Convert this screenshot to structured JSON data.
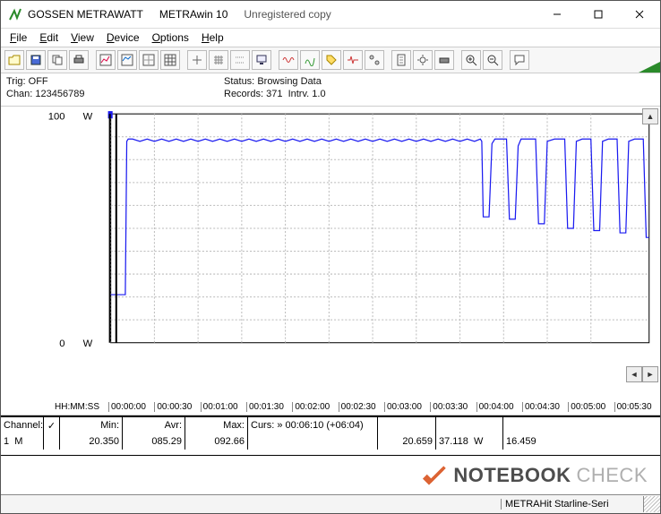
{
  "title": {
    "vendor": "GOSSEN METRAWATT",
    "app": "METRAwin 10",
    "status": "Unregistered copy"
  },
  "menu": {
    "file": "File",
    "edit": "Edit",
    "view": "View",
    "device": "Device",
    "options": "Options",
    "help": "Help"
  },
  "status": {
    "trig_label": "Trig:",
    "trig": "OFF",
    "chan_label": "Chan:",
    "chan": "123456789",
    "status_label": "Status:",
    "status": "Browsing Data",
    "records_label": "Records:",
    "records": "371",
    "intrv_label": "Intrv.",
    "intrv": "1.0"
  },
  "chart_data": {
    "type": "line",
    "title": "",
    "xlabel": "HH:MM:SS",
    "ylabel": "W",
    "ylim": [
      0,
      100
    ],
    "y_ticks": [
      0,
      100
    ],
    "y_unit": "W",
    "x_ticks": [
      "00:00:00",
      "00:00:30",
      "00:01:00",
      "00:01:30",
      "00:02:00",
      "00:02:30",
      "00:03:00",
      "00:03:30",
      "00:04:00",
      "00:04:30",
      "00:05:00",
      "00:05:30"
    ],
    "x_range_seconds": [
      0,
      370
    ],
    "series": [
      {
        "name": "Channel 1",
        "color": "#1a1af0",
        "points": [
          [
            0,
            21
          ],
          [
            3,
            21
          ],
          [
            4,
            21
          ],
          [
            5,
            21
          ],
          [
            6,
            21
          ],
          [
            7,
            21
          ],
          [
            8,
            21
          ],
          [
            9,
            21
          ],
          [
            10,
            21
          ],
          [
            11,
            88
          ],
          [
            12,
            89
          ],
          [
            15,
            89
          ],
          [
            20,
            88
          ],
          [
            25,
            89
          ],
          [
            30,
            88
          ],
          [
            35,
            89
          ],
          [
            40,
            88
          ],
          [
            45,
            89
          ],
          [
            50,
            88
          ],
          [
            55,
            89
          ],
          [
            60,
            88
          ],
          [
            65,
            89
          ],
          [
            70,
            88
          ],
          [
            75,
            89
          ],
          [
            80,
            88
          ],
          [
            85,
            89
          ],
          [
            90,
            88
          ],
          [
            95,
            89
          ],
          [
            100,
            88
          ],
          [
            105,
            89
          ],
          [
            110,
            88
          ],
          [
            115,
            89
          ],
          [
            120,
            88
          ],
          [
            125,
            89
          ],
          [
            130,
            88
          ],
          [
            135,
            89
          ],
          [
            140,
            88
          ],
          [
            145,
            89
          ],
          [
            150,
            88
          ],
          [
            155,
            89
          ],
          [
            160,
            88
          ],
          [
            165,
            89
          ],
          [
            170,
            88
          ],
          [
            175,
            89
          ],
          [
            180,
            88
          ],
          [
            185,
            89
          ],
          [
            190,
            88
          ],
          [
            195,
            89
          ],
          [
            200,
            88
          ],
          [
            205,
            89
          ],
          [
            210,
            88
          ],
          [
            215,
            89
          ],
          [
            220,
            88
          ],
          [
            225,
            89
          ],
          [
            230,
            88
          ],
          [
            235,
            89
          ],
          [
            240,
            88
          ],
          [
            245,
            89
          ],
          [
            250,
            88
          ],
          [
            254,
            89
          ],
          [
            255,
            88
          ],
          [
            256,
            55
          ],
          [
            258,
            55
          ],
          [
            260,
            55
          ],
          [
            262,
            87
          ],
          [
            264,
            89
          ],
          [
            268,
            89
          ],
          [
            272,
            89
          ],
          [
            274,
            54
          ],
          [
            276,
            54
          ],
          [
            278,
            54
          ],
          [
            280,
            86
          ],
          [
            282,
            89
          ],
          [
            288,
            89
          ],
          [
            292,
            89
          ],
          [
            294,
            52
          ],
          [
            296,
            52
          ],
          [
            298,
            52
          ],
          [
            300,
            88
          ],
          [
            305,
            89
          ],
          [
            310,
            89
          ],
          [
            312,
            89
          ],
          [
            314,
            50
          ],
          [
            316,
            50
          ],
          [
            318,
            50
          ],
          [
            320,
            88
          ],
          [
            324,
            89
          ],
          [
            328,
            89
          ],
          [
            330,
            89
          ],
          [
            332,
            49
          ],
          [
            334,
            49
          ],
          [
            336,
            49
          ],
          [
            338,
            88
          ],
          [
            342,
            89
          ],
          [
            346,
            89
          ],
          [
            348,
            89
          ],
          [
            350,
            48
          ],
          [
            352,
            48
          ],
          [
            354,
            48
          ],
          [
            356,
            88
          ],
          [
            360,
            89
          ],
          [
            364,
            89
          ],
          [
            366,
            89
          ],
          [
            368,
            46
          ],
          [
            370,
            46
          ]
        ]
      }
    ]
  },
  "grid": {
    "hdr": {
      "channel": "Channel:",
      "min": "Min:",
      "avr": "Avr:",
      "max": "Max:",
      "curs": "Curs: » 00:06:10 (+06:04)"
    },
    "row": {
      "ch": "1",
      "unit": "M",
      "min": "20.350",
      "avr": "085.29",
      "max": "092.66",
      "v1": "20.659",
      "v2": "37.118",
      "v2u": "W",
      "v3": "16.459"
    },
    "checkbox": "✓"
  },
  "footer": {
    "device": "METRAHit Starline-Seri"
  },
  "watermark": {
    "a": "NOTEBOOK",
    "b": "CHECK"
  }
}
